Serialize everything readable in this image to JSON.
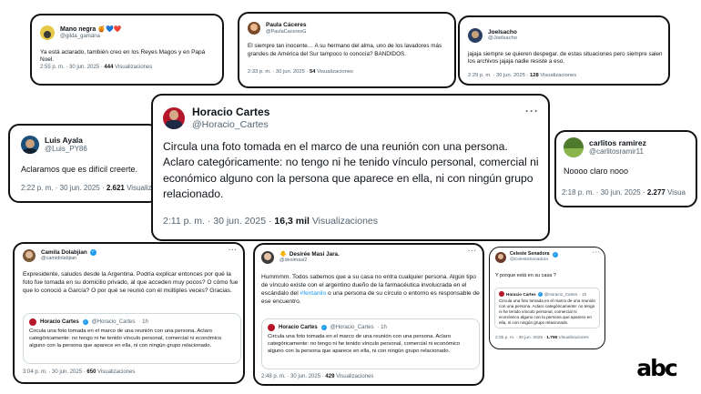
{
  "tweets": [
    {
      "name": "Mano negra 🍯💙❤️",
      "handle": "@gilda_gamana",
      "text": "Ya está aclarado, también creo en los Reyes Magos y en Papá Noel.",
      "time": "2:55 p. m. · 30 jun. 2025 ·",
      "views_count": "444",
      "views_label": "Visualizaciones"
    },
    {
      "name": "Paula Cáceres",
      "handle": "@PaulaCaceresG",
      "text": "El siempre tan inocente… A su hermano del alma, uno de los lavadores más grandes de América del Sur tampoco lo conocía? BANDIDOS.",
      "time": "2:33 p. m. · 30 jun. 2025 ·",
      "views_count": "54",
      "views_label": "Visualizaciones"
    },
    {
      "name": "Joelsacho",
      "handle": "@Joelsacho",
      "text": "jajaja siempre se quieren despegar. de estas situaciones pero siempre salen los archivos jajaja nadie resiste a eso.",
      "time": "2:29 p. m. · 30 jun. 2025 ·",
      "views_count": "128",
      "views_label": "Visualizaciones"
    },
    {
      "name": "Luis Ayala",
      "handle": "@Luis_PY86",
      "text": "Aclaramos que es difícil creerte.",
      "time": "2:22 p. m. · 30 jun. 2025 ·",
      "views_count": "2.621",
      "views_label": "Visualiza"
    },
    {
      "name": "Horacio Cartes",
      "handle": "@Horacio_Cartes",
      "text": "Circula una foto tomada en el marco de una reunión con una persona. Aclaro categóricamente: no tengo ni he tenido vínculo personal, comercial ni económico alguno con la persona que aparece en ella, ni con ningún grupo relacionado.",
      "time": "2:11 p. m. · 30 jun. 2025 ·",
      "views_count": "16,3 mil",
      "views_label": "Visualizaciones"
    },
    {
      "name": "carlitos ramirez",
      "handle": "@carlitosramir11",
      "text": "Noooo claro nooo",
      "time": "2:18 p. m. · 30 jun. 2025 ·",
      "views_count": "2.277",
      "views_label": "Visua"
    },
    {
      "name": "Camila Dolabjian",
      "handle": "@camidolabjian",
      "text": "Expresidente, saludos desde la Argentina. Podría explicar entonces por qué la foto fue tomada en su domicilio privado, al que acceden muy pocos? O cómo fue que lo conoció a García? O por qué se reunió con él múltiples veces? Gracias.",
      "time": "3:04 p. m. · 30 jun. 2025 ·",
      "views_count": "650",
      "views_label": "Visualizaciones"
    },
    {
      "name": "Desirée Masi Jara.",
      "name_prefix": "🐥",
      "handle": "@desimasi2",
      "text_before": "Hummmm. Todos sabemos que a su casa no entra cualquier persona. Algún tipo de vínculo existe con el argentino dueño de la farmacéutica involucrada en el escándalo del ",
      "hashtag": "#fentanilo",
      "text_after": " o una persona de su círculo o entorno es responsable de ese encuentro.",
      "time": "2:48 p. m. · 30 jun. 2025 ·",
      "views_count": "429",
      "views_label": "Visualizaciones"
    },
    {
      "name": "Celeste Senadora",
      "handle": "@CelesteSenadora",
      "text": "Y porque está en su casa ?",
      "time": "2:35 p. m. · 30 jun. 2025 ·",
      "views_count": "1.790",
      "views_label": "Visualizaciones"
    }
  ],
  "quoted": {
    "name": "Horacio Cartes",
    "handle": "@Horacio_Cartes",
    "age": "· 1h",
    "text": "Circula una foto tomada en el marco de una reunión con una persona. Aclaro categóricamente: no tengo ni he tenido vínculo personal, comercial ni económico alguno con la persona que aparece en ella, ni con ningún grupo relacionado."
  },
  "more_label": "···",
  "verified_glyph": "✓",
  "logo_text": "abc",
  "colors": {
    "link": "#1d9bf0",
    "muted": "#536471",
    "text": "#0f1419",
    "border": "#111111"
  },
  "icons": [
    "avatar",
    "verified-badge-icon",
    "more-options-icon",
    "abc-logo"
  ]
}
